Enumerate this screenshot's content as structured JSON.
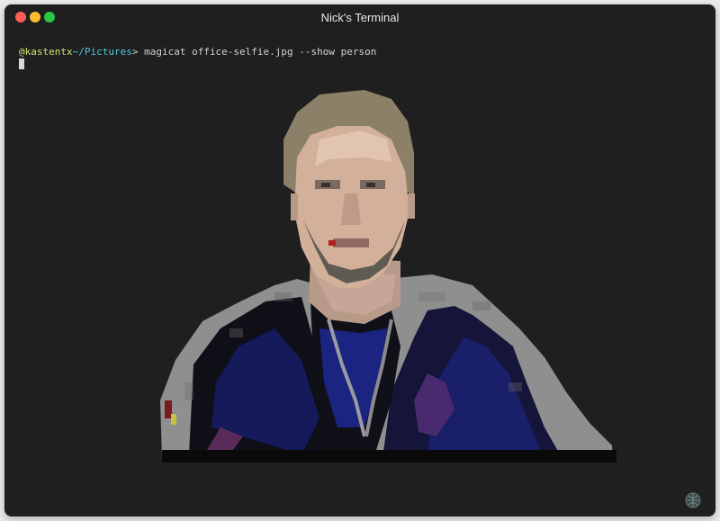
{
  "window": {
    "title": "Nick's Terminal"
  },
  "prompt": {
    "user": "@kastentx",
    "path": "~/Pictures",
    "separator": ">",
    "command": " magicat office-selfie.jpg --show person"
  },
  "icons": {
    "close": "close-dot",
    "minimize": "minimize-dot",
    "maximize": "maximize-dot",
    "badge": "globe-badge-icon"
  },
  "colors": {
    "terminal_bg": "#1f1f1f",
    "prompt_user": "#cde66a",
    "prompt_path": "#52c8dc",
    "text": "#d0d0d0"
  }
}
